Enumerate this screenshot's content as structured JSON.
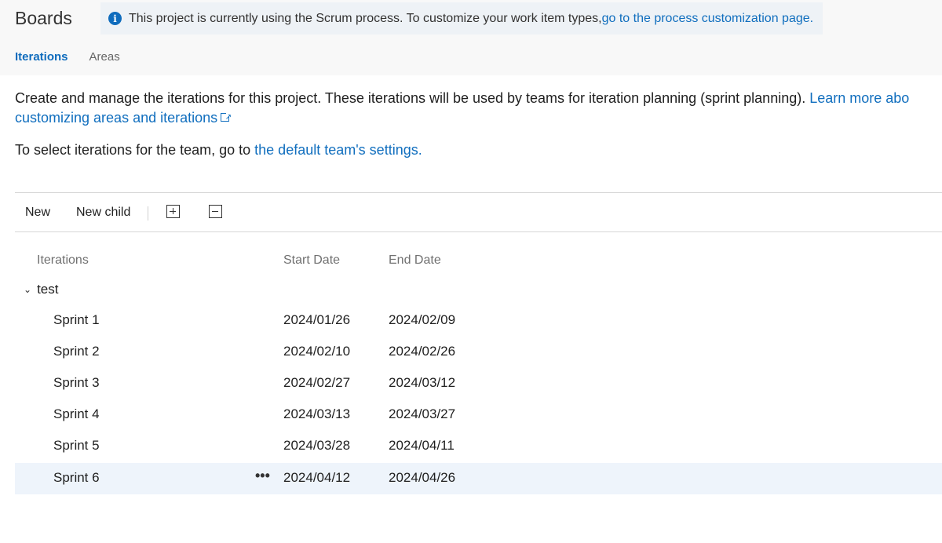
{
  "header": {
    "title": "Boards",
    "info_text": "This project is currently using the Scrum process. To customize your work item types, ",
    "info_link": "go to the process customization page.",
    "info_icon": "info-icon"
  },
  "tabs": [
    {
      "label": "Iterations",
      "active": true
    },
    {
      "label": "Areas",
      "active": false
    }
  ],
  "description": {
    "text": "Create and manage the iterations for this project. These iterations will be used by teams for iteration planning (sprint planning). ",
    "link_line1": "Learn more abo",
    "link_line2": "customizing areas and iterations"
  },
  "team_line": {
    "text": "To select iterations for the team, go to ",
    "link": "the default team's settings."
  },
  "toolbar": {
    "new_label": "New",
    "new_child_label": "New child",
    "expand_icon": "expand-all-icon",
    "collapse_icon": "collapse-all-icon"
  },
  "table": {
    "columns": [
      "Iterations",
      "Start Date",
      "End Date"
    ],
    "group": "test",
    "rows": [
      {
        "name": "Sprint 1",
        "start": "2024/01/26",
        "end": "2024/02/09"
      },
      {
        "name": "Sprint 2",
        "start": "2024/02/10",
        "end": "2024/02/26"
      },
      {
        "name": "Sprint 3",
        "start": "2024/02/27",
        "end": "2024/03/12"
      },
      {
        "name": "Sprint 4",
        "start": "2024/03/13",
        "end": "2024/03/27"
      },
      {
        "name": "Sprint 5",
        "start": "2024/03/28",
        "end": "2024/04/11"
      },
      {
        "name": "Sprint 6",
        "start": "2024/04/12",
        "end": "2024/04/26",
        "selected": true
      }
    ],
    "more_label": "•••"
  },
  "colors": {
    "accent": "#0f6cbd",
    "link": "#106ebe",
    "selected_row": "#eef4fb"
  }
}
